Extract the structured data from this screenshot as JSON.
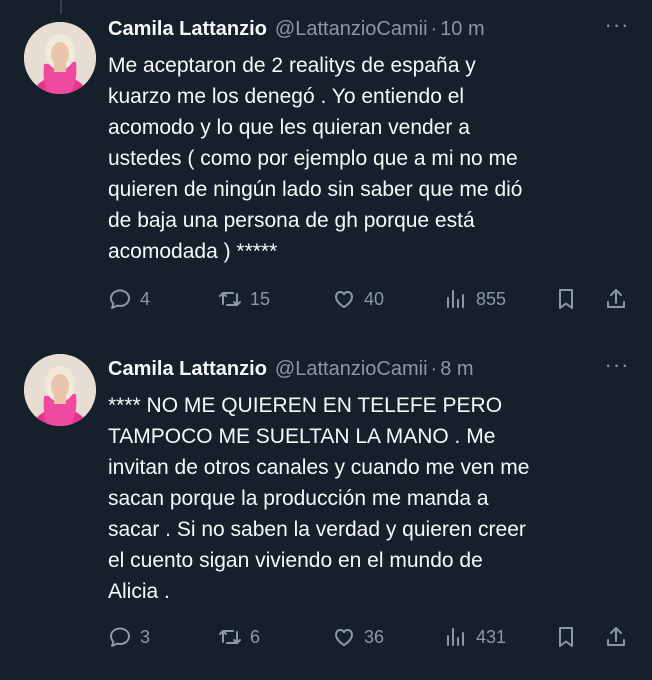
{
  "tweets": [
    {
      "author_name": "Camila Lattanzio",
      "handle": "@LattanzioCamii",
      "separator": "·",
      "time": "10 m",
      "more_label": "···",
      "text": "Me aceptaron de 2 realitys  de españa y\nkuarzo me los denegó .  Yo entiendo el\nacomodo y lo que les quieran vender a\nustedes ( como por ejemplo que a mi no me\nquieren de ningún lado sin saber que  me dió\nde baja una persona de gh porque está\nacomodada ) *****",
      "replies": "4",
      "retweets": "15",
      "likes": "40",
      "views": "855"
    },
    {
      "author_name": "Camila Lattanzio",
      "handle": "@LattanzioCamii",
      "separator": "·",
      "time": "8 m",
      "more_label": "···",
      "text": "**** NO ME QUIEREN EN TELEFE PERO\nTAMPOCO ME SUELTAN LA MANO . Me\ninvitan de otros canales y cuando me ven me\nsacan porque la producción me manda a\nsacar .  Si no saben la verdad y quieren creer\nel cuento sigan viviendo en el mundo de\nAlicia .",
      "replies": "3",
      "retweets": "6",
      "likes": "36",
      "views": "431"
    }
  ],
  "colors": {
    "background": "#15202b",
    "text": "#f7f9f9",
    "secondary": "#8b98a5",
    "thread_line": "#38444d"
  },
  "icons": [
    "reply-icon",
    "retweet-icon",
    "like-icon",
    "views-icon",
    "bookmark-icon",
    "share-icon",
    "more-icon"
  ]
}
